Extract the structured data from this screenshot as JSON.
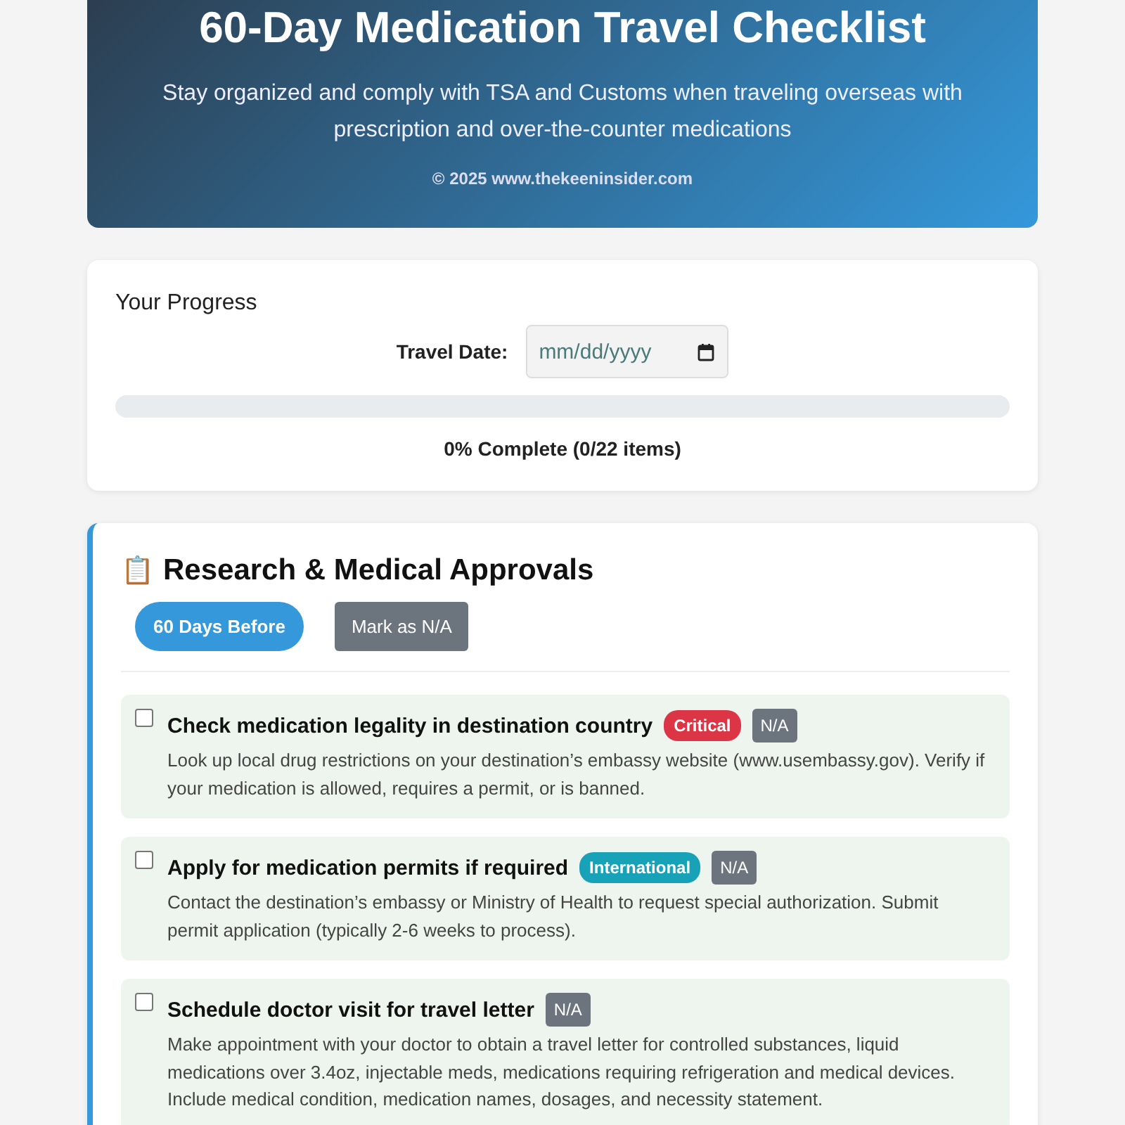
{
  "header": {
    "title": "60-Day Medication Travel Checklist",
    "subtitle": "Stay organized and comply with TSA and Customs when traveling overseas with prescription and over-the-counter medications",
    "copyright": "© 2025 www.thekeeninsider.com"
  },
  "progress": {
    "heading": "Your Progress",
    "date_label": "Travel Date:",
    "date_placeholder": "mm/dd/yyyy",
    "level": 0,
    "summary": "0% Complete (0/22 items)"
  },
  "section": {
    "icon": "📋",
    "title": "Research & Medical Approvals",
    "timing": "60 Days Before",
    "na_button": "Mark as N/A",
    "items": [
      {
        "title": "Check medication legality in destination country",
        "checked": false,
        "tag": {
          "label": "Critical",
          "color": "#dc3545"
        },
        "na": "N/A",
        "description": "Look up local drug restrictions on your destination’s embassy website (www.usembassy.gov). Verify if your medication is allowed, requires a permit, or is banned."
      },
      {
        "title": "Apply for medication permits if required",
        "checked": false,
        "tag": {
          "label": "International",
          "color": "#17a2b8"
        },
        "na": "N/A",
        "description": "Contact the destination’s embassy or Ministry of Health to request special authorization. Submit permit application (typically 2-6 weeks to process)."
      },
      {
        "title": "Schedule doctor visit for travel letter",
        "checked": false,
        "na": "N/A",
        "description": "Make appointment with your doctor to obtain a travel letter for controlled substances, liquid medications over 3.4oz, injectable meds, medications requiring refrigeration and medical devices. Include medical condition, medication names, dosages, and necessity statement."
      }
    ]
  }
}
